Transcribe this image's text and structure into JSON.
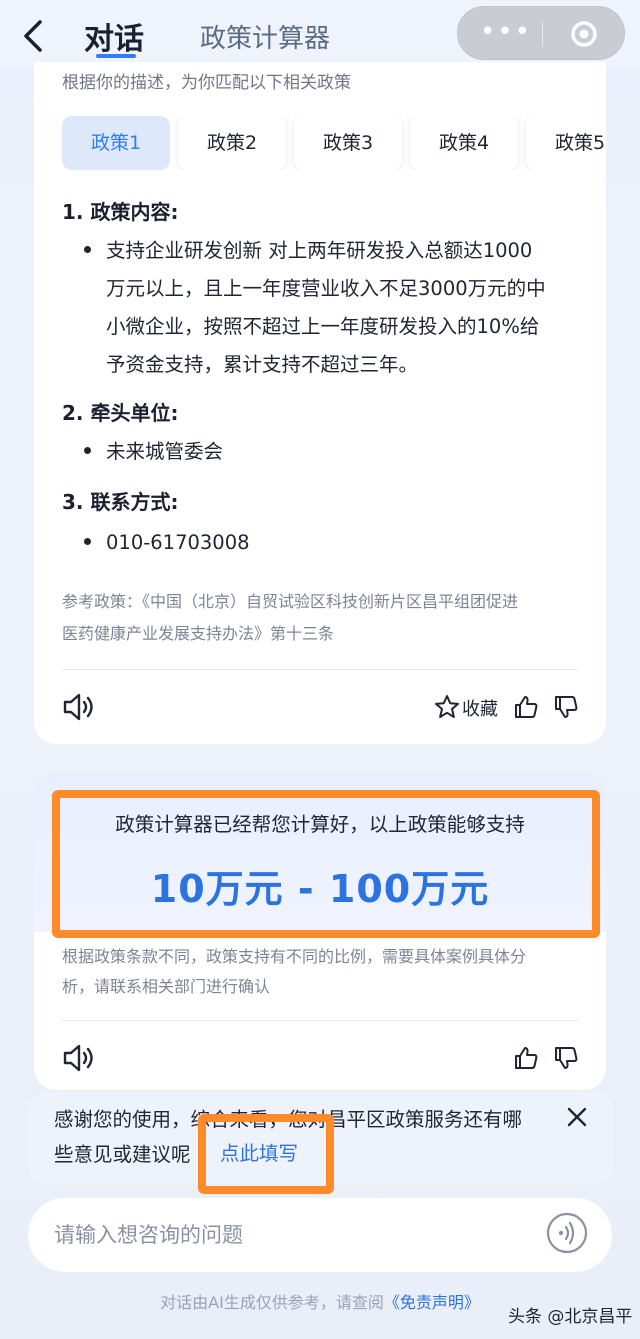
{
  "header": {
    "tab_active": "对话",
    "tab_inactive": "政策计算器"
  },
  "card1": {
    "intro": "根据你的描述，为你匹配以下相关政策",
    "tabs": [
      "政策1",
      "政策2",
      "政策3",
      "政策4",
      "政策5"
    ],
    "section1_title": "1. 政策内容:",
    "section1_lines": [
      "支持企业研发创新 对上两年研发投入总额达1000",
      "万元以上，且上一年度营业收入不足3000万元的中",
      "小微企业，按照不超过上一年度研发投入的10%给",
      "予资金支持，累计支持不超过三年。"
    ],
    "section2_title": "2. 牵头单位:",
    "section2_value": "未来城管委会",
    "section3_title": "3. 联系方式:",
    "section3_value": "010-61703008",
    "ref_lines": [
      "参考政策：《中国（北京）自贸试验区科技创新片区昌平组团促进",
      "医药健康产业发展支持办法》第十三条"
    ],
    "collect_label": "收藏"
  },
  "card2": {
    "calc_line": "政策计算器已经帮您计算好，以上政策能够支持",
    "calc_range": "10万元 - 100万元",
    "note_lines": [
      "根据政策条款不同，政策支持有不同的比例，需要具体案例具体分",
      "析，请联系相关部门进行确认"
    ]
  },
  "feedback": {
    "line1": "感谢您的使用，综合来看，您对昌平区政策服务还有哪",
    "line2": "些意见或建议呢",
    "link": "点此填写"
  },
  "input": {
    "placeholder": "请输入想咨询的问题"
  },
  "footer": {
    "text": "对话由AI生成仅供参考，请查阅",
    "link": "《免责声明》"
  },
  "watermark": "头条 @北京昌平",
  "colors": {
    "accent": "#2f7bff",
    "highlight_border": "#ff8a2a",
    "range_text": "#2c73e0"
  }
}
